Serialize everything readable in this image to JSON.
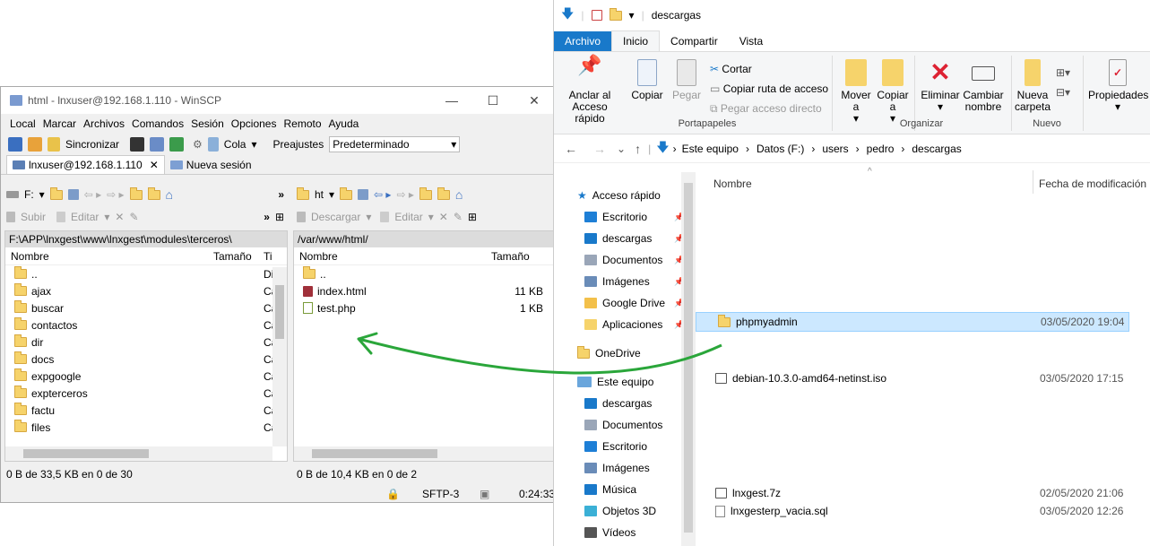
{
  "winscp": {
    "title": "html - lnxuser@192.168.1.110 - WinSCP",
    "menu": [
      "Local",
      "Marcar",
      "Archivos",
      "Comandos",
      "Sesión",
      "Opciones",
      "Remoto",
      "Ayuda"
    ],
    "toolbar": {
      "sync": "Sincronizar",
      "queue": "Cola",
      "presets_label": "Preajustes",
      "presets_value": "Predeterminado"
    },
    "tabs": {
      "session": "lnxuser@192.168.1.110",
      "new_session": "Nueva sesión"
    },
    "left": {
      "drive": "F:",
      "upload": "Subir",
      "edit": "Editar",
      "path": "F:\\APP\\lnxgest\\www\\lnxgest\\modules\\terceros\\",
      "columns": {
        "name": "Nombre",
        "size": "Tamaño",
        "type": "Ti"
      },
      "rows": [
        {
          "name": "..",
          "type": "Di"
        },
        {
          "name": "ajax",
          "type": "Ca"
        },
        {
          "name": "buscar",
          "type": "Ca"
        },
        {
          "name": "contactos",
          "type": "Ca"
        },
        {
          "name": "dir",
          "type": "Ca"
        },
        {
          "name": "docs",
          "type": "Ca"
        },
        {
          "name": "expgoogle",
          "type": "Ca"
        },
        {
          "name": "expterceros",
          "type": "Ca"
        },
        {
          "name": "factu",
          "type": "Ca"
        },
        {
          "name": "files",
          "type": "Ca"
        }
      ],
      "status": "0 B de 33,5 KB en 0 de 30"
    },
    "right": {
      "drive": "ht",
      "download": "Descargar",
      "edit": "Editar",
      "path": "/var/www/html/",
      "columns": {
        "name": "Nombre",
        "size": "Tamaño"
      },
      "rows": [
        {
          "name": "..",
          "size": ""
        },
        {
          "name": "index.html",
          "size": "11 KB"
        },
        {
          "name": "test.php",
          "size": "1 KB"
        }
      ],
      "status": "0 B de 10,4 KB en 0 de 2"
    },
    "statusbar": {
      "protocol": "SFTP-3",
      "time": "0:24:33"
    }
  },
  "explorer": {
    "title": "descargas",
    "tabs": [
      "Archivo",
      "Inicio",
      "Compartir",
      "Vista"
    ],
    "ribbon": {
      "pin": "Anclar al Acceso rápido",
      "copy": "Copiar",
      "paste": "Pegar",
      "cut": "Cortar",
      "copy_path": "Copiar ruta de acceso",
      "paste_shortcut": "Pegar acceso directo",
      "group_clipboard": "Portapapeles",
      "move_to": "Mover a",
      "copy_to": "Copiar a",
      "delete": "Eliminar",
      "rename": "Cambiar nombre",
      "group_organize": "Organizar",
      "new_folder": "Nueva carpeta",
      "group_new": "Nuevo",
      "properties": "Propiedades"
    },
    "breadcrumb": [
      "Este equipo",
      "Datos (F:)",
      "users",
      "pedro",
      "descargas"
    ],
    "nav": {
      "quick_access": "Acceso rápido",
      "pinned": [
        "Escritorio",
        "descargas",
        "Documentos",
        "Imágenes",
        "Google Drive",
        "Aplicaciones"
      ],
      "onedrive": "OneDrive",
      "this_pc": "Este equipo",
      "pc_items": [
        "descargas",
        "Documentos",
        "Escritorio",
        "Imágenes",
        "Música",
        "Objetos 3D",
        "Vídeos"
      ]
    },
    "columns": {
      "name": "Nombre",
      "date": "Fecha de modificación"
    },
    "files": [
      {
        "name": "phpmyadmin",
        "date": "03/05/2020 19:04",
        "kind": "folder",
        "selected": true
      },
      {
        "name": "debian-10.3.0-amd64-netinst.iso",
        "date": "03/05/2020 17:15",
        "kind": "iso"
      },
      {
        "name": "lnxgest.7z",
        "date": "02/05/2020 21:06",
        "kind": "archive"
      },
      {
        "name": "lnxgesterp_vacia.sql",
        "date": "03/05/2020 12:26",
        "kind": "sql"
      }
    ]
  },
  "colors": {
    "accent": "#1979ca",
    "arrow": "#2aa63a",
    "selection": "#cce8ff"
  }
}
